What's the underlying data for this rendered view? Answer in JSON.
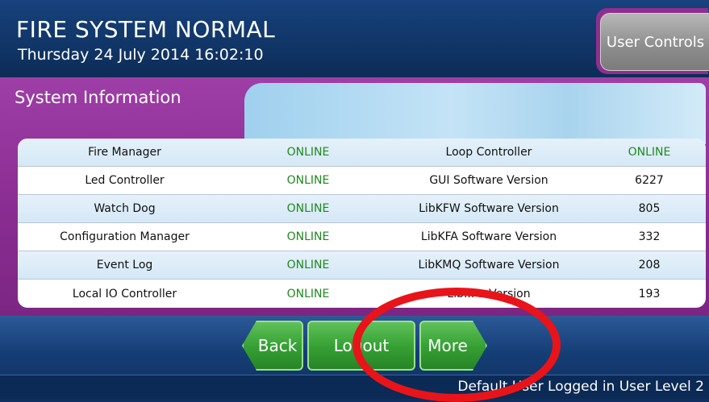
{
  "header": {
    "title": "FIRE SYSTEM NORMAL",
    "datetime": "Thursday 24 July 2014 16:02:10",
    "user_controls_label": "User Controls"
  },
  "panel": {
    "title": "System Information"
  },
  "table": {
    "rows": [
      {
        "name": "Fire Manager",
        "status": "ONLINE",
        "item": "Loop Controller",
        "value": "ONLINE"
      },
      {
        "name": "Led Controller",
        "status": "ONLINE",
        "item": "GUI Software Version",
        "value": "6227"
      },
      {
        "name": "Watch Dog",
        "status": "ONLINE",
        "item": "LibKFW Software Version",
        "value": "805"
      },
      {
        "name": "Configuration Manager",
        "status": "ONLINE",
        "item": "LibKFA Software Version",
        "value": "332"
      },
      {
        "name": "Event Log",
        "status": "ONLINE",
        "item": "LibKMQ Software Version",
        "value": "208"
      },
      {
        "name": "Local IO Controller",
        "status": "ONLINE",
        "item": "Lib... ...Version",
        "value": "193"
      }
    ]
  },
  "nav": {
    "back_label": "Back",
    "logout_label": "Logout",
    "more_label": "More"
  },
  "status_bar": {
    "text": "Default User Logged in User Level 2"
  },
  "colors": {
    "online": "#1f8a1f",
    "panel": "#8e2f8f",
    "header": "#103566",
    "highlight": "#e8141a"
  }
}
